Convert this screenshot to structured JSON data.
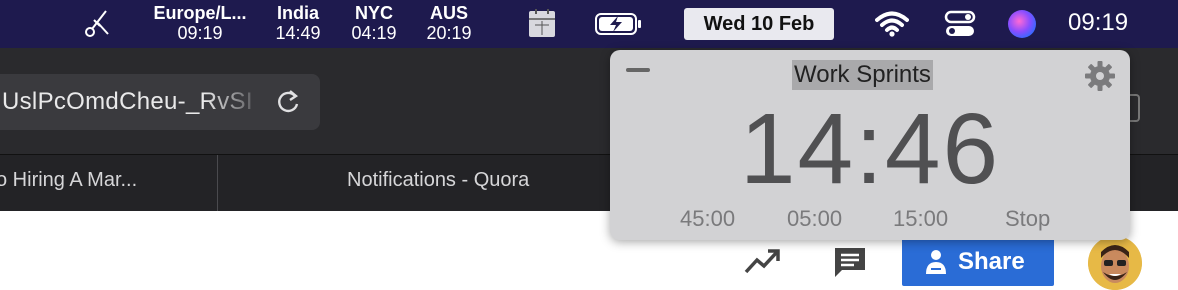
{
  "menubar": {
    "world_clocks": [
      {
        "city": "Europe/L...",
        "time": "09:19"
      },
      {
        "city": "India",
        "time": "14:49"
      },
      {
        "city": "NYC",
        "time": "04:19"
      },
      {
        "city": "AUS",
        "time": "20:19"
      }
    ],
    "date": "Wed 10 Feb",
    "time": "09:19",
    "bg_color": "#1e1a4e"
  },
  "browser": {
    "url": "UslPcOmdCheu-_RvSI",
    "tabs": [
      {
        "label": "o Hiring A Mar..."
      },
      {
        "label": "Notifications - Quora"
      }
    ]
  },
  "page": {
    "share_label": "Share",
    "share_color": "#2a6cd6"
  },
  "timer_popup": {
    "title": "Work Sprints",
    "time": "14:46",
    "presets": [
      "45:00",
      "05:00",
      "15:00",
      "Stop"
    ]
  },
  "icons": [
    "scissors-icon",
    "calendar-icon",
    "battery-charging-icon",
    "wifi-icon",
    "control-center-icon",
    "siri-icon",
    "reload-icon",
    "trending-icon",
    "comment-icon",
    "share-person-icon",
    "avatar",
    "minus-icon",
    "gear-icon"
  ]
}
